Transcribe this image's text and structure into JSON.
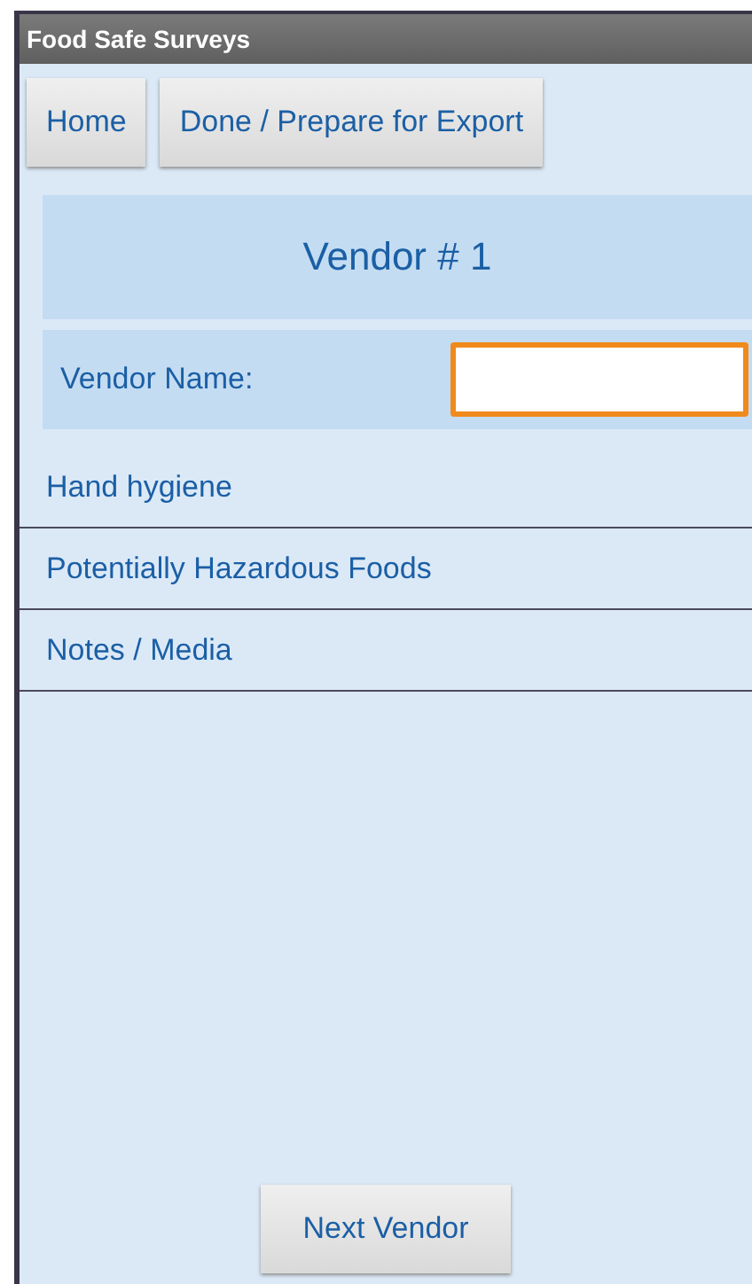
{
  "window": {
    "title": "Food Safe Surveys"
  },
  "toolbar": {
    "buttons": [
      "Home",
      "Done / Prepare for Export"
    ]
  },
  "vendor": {
    "heading": "Vendor # 1",
    "name_label": "Vendor Name:",
    "name_field": {
      "focused": true
    }
  },
  "sections": [
    {
      "label": "Hand hygiene"
    },
    {
      "label": "Potentially Hazardous Foods"
    },
    {
      "label": "Notes / Media"
    }
  ],
  "footer": {
    "button": "Next Vendor"
  }
}
